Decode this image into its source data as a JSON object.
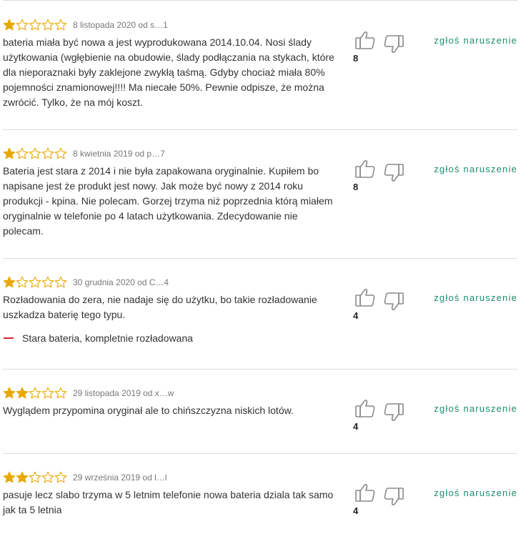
{
  "colors": {
    "star_filled": "#e8a800",
    "star_empty": "#e8a800",
    "report_link": "#1e8a6e",
    "con_dash": "#d9262b"
  },
  "icons": {
    "star_filled": "star-filled-icon",
    "star_empty": "star-outline-icon",
    "thumb_up": "thumbs-up-icon",
    "thumb_down": "thumbs-down-icon"
  },
  "reviews": [
    {
      "rating": 1,
      "meta": "8 listopada 2020 od s…1",
      "text": "bateria miała być nowa a jest wyprodukowana 2014.10.04. Nosi ślady użytkowania (wgłębienie na obudowie, ślady podłączania na stykach, które dla nieporaznaki były zaklejone zwykłą taśmą. Gdyby chociaż miała 80% pojemności znamionowej!!!! Ma niecałe 50%. Pewnie odpisze, że można zwrócić. Tylko, że na mój koszt.",
      "con": "",
      "votes": "8",
      "report": "zgłoś naruszenie"
    },
    {
      "rating": 1,
      "meta": "8 kwietnia 2019 od p…7",
      "text": "Bateria jest stara z 2014 i nie była zapakowana oryginalnie. Kupiłem bo napisane jest że produkt jest nowy. Jak może być nowy z 2014 roku produkcji - kpina. Nie polecam. Gorzej trzyma niż poprzednia którą miałem oryginalnie w telefonie po 4 latach użytkowania. Zdecydowanie nie polecam.",
      "con": "",
      "votes": "8",
      "report": "zgłoś naruszenie"
    },
    {
      "rating": 1,
      "meta": "30 grudnia 2020 od C…4",
      "text": "Rozładowania do zera, nie nadaje się do użytku, bo takie rozładowanie uszkadza baterię tego typu.",
      "con": "Stara bateria, kompletnie rozładowana",
      "votes": "4",
      "report": "zgłoś naruszenie"
    },
    {
      "rating": 2,
      "meta": "29 listopada 2019 od x…w",
      "text": "Wyglądem przypomina oryginał ale to chińszczyzna niskich lotów.",
      "con": "",
      "votes": "4",
      "report": "zgłoś naruszenie"
    },
    {
      "rating": 2,
      "meta": "29 września 2019 od l…l",
      "text": "pasuje lecz slabo trzyma w 5 letnim telefonie nowa bateria dziala tak samo jak ta 5 letnia",
      "con": "",
      "votes": "4",
      "report": "zgłoś naruszenie"
    }
  ]
}
